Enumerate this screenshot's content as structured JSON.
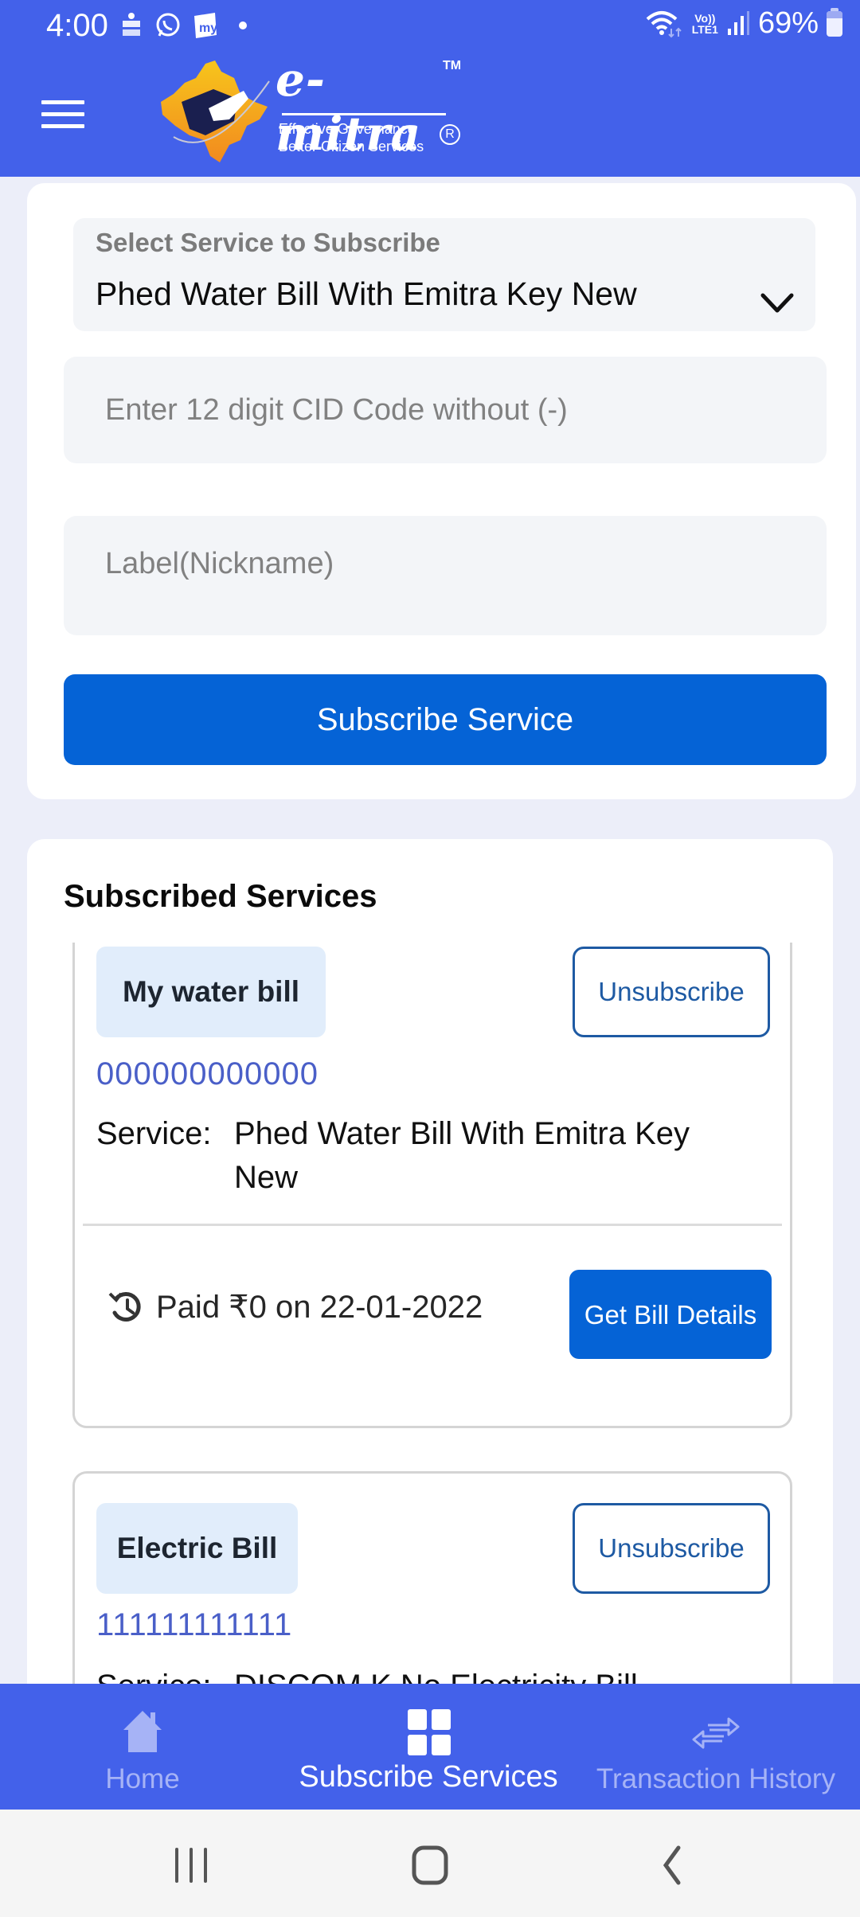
{
  "status_bar": {
    "time": "4:00",
    "left_icons": [
      "dainik-bhaskar-icon",
      "whatsapp-icon",
      "my-app-icon",
      "notification-dot"
    ],
    "network_label_top": "Vo))",
    "network_label_bottom": "LTE1",
    "battery_percent": "69%",
    "battery_level": 0.69
  },
  "header": {
    "logo": {
      "wordmark": "e-mitra",
      "trademark": "TM",
      "tagline_1": "Effective Governance",
      "tagline_2": "Better Citizen Services",
      "registered": "R"
    }
  },
  "subscribe_form": {
    "select": {
      "label": "Select Service to Subscribe",
      "value": "Phed Water Bill With Emitra Key New"
    },
    "cid_input": {
      "value": "",
      "placeholder": "Enter 12 digit CID Code without (-)"
    },
    "label_input": {
      "value": "",
      "placeholder": "Label(Nickname)"
    },
    "subscribe_button": "Subscribe Service"
  },
  "subscribed_services": {
    "title": "Subscribed Services",
    "service_prefix": "Service:",
    "unsubscribe_label": "Unsubscribe",
    "items": [
      {
        "nickname": "My water bill",
        "account_number": "000000000000",
        "service": "Phed Water Bill With Emitra Key New",
        "last_payment": "Paid ₹0 on 22-01-2022",
        "bill_button": "Get Bill Details"
      },
      {
        "nickname": "Electric Bill",
        "account_number": "111111111111",
        "service": "DISCOM K No Electricity Bill"
      }
    ]
  },
  "bottom_nav": {
    "items": [
      {
        "label": "Home",
        "icon": "home-icon",
        "active": false
      },
      {
        "label": "Subscribe Services",
        "icon": "grid-icon",
        "active": true
      },
      {
        "label": "Transaction History",
        "icon": "transfer-arrows-icon",
        "active": false
      }
    ]
  },
  "colors": {
    "brand_blue": "#4361ea",
    "primary_button": "#0563d6",
    "outline_button": "#1e5aa3",
    "account_number": "#4a5fc8",
    "nickname_badge": "#e1edfb",
    "page_bg": "#eceef9",
    "nav_inactive": "#a6b3f6"
  }
}
